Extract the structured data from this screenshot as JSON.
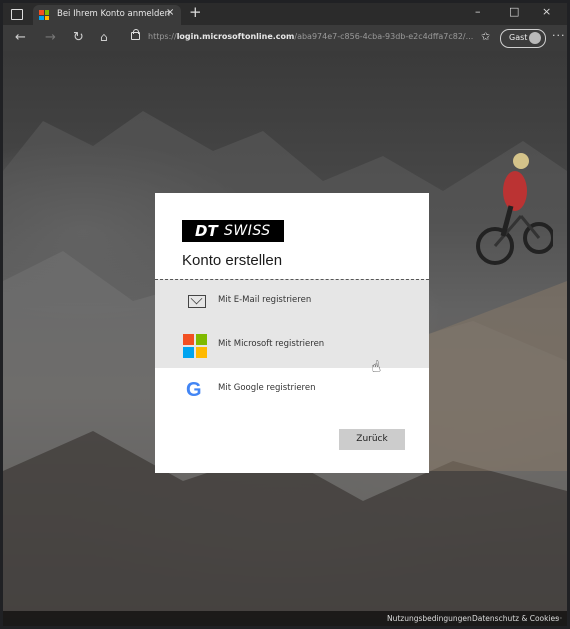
{
  "browser": {
    "tab_title": "Bei Ihrem Konto anmelden",
    "tab_close": "×",
    "new_tab": "+",
    "window_controls": [
      "–",
      "□",
      "×"
    ],
    "url_prefix": "https://",
    "url_host": "login.microsoftonline.com",
    "url_path": "/aba974e7-c856-4cba-93db-e2c4dffa7c82/...",
    "guest_label": "Gast",
    "more_label": "···",
    "icons": [
      "tab-actions-icon",
      "back-icon",
      "forward-icon",
      "refresh-icon",
      "home-icon",
      "lock-icon",
      "favorites-icon",
      "avatar-icon",
      "more-icon"
    ]
  },
  "modal": {
    "logo_dt": "DT",
    "logo_swiss": "SWISS",
    "title": "Konto erstellen",
    "options": [
      {
        "label": "Mit E-Mail registrieren",
        "icon": "mail-icon"
      },
      {
        "label": "Mit Microsoft registrieren",
        "icon": "microsoft-icon"
      },
      {
        "label": "Mit Google registrieren",
        "icon": "google-icon"
      }
    ],
    "back_label": "Zurück"
  },
  "footer": {
    "terms": "Nutzungsbedingungen",
    "privacy": "Datenschutz & Cookies",
    "more": "···"
  },
  "colors": {
    "ms_red": "#F25022",
    "ms_green": "#7FBA00",
    "ms_blue": "#00A4EF",
    "ms_yellow": "#FFB900",
    "google_blue": "#4285F4"
  }
}
